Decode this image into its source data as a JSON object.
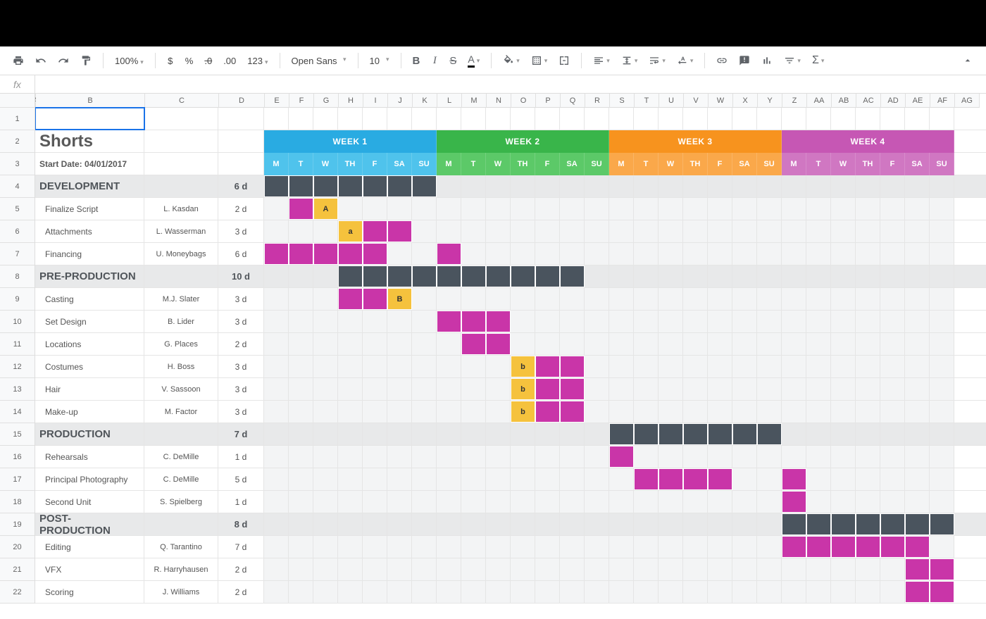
{
  "toolbar": {
    "zoom": "100%",
    "currency": "$",
    "percent": "%",
    "dec_dec": ".0",
    "dec_inc": ".00",
    "format123": "123",
    "font": "Open Sans",
    "fontsize": "10"
  },
  "columns": [
    "A",
    "B",
    "C",
    "D",
    "E",
    "F",
    "G",
    "H",
    "I",
    "J",
    "K",
    "L",
    "M",
    "N",
    "O",
    "P",
    "Q",
    "R",
    "S",
    "T",
    "U",
    "V",
    "W",
    "X",
    "Y",
    "Z",
    "AA",
    "AB",
    "AC",
    "AD",
    "AE",
    "AF",
    "AG"
  ],
  "rownums": [
    "1",
    "2",
    "3",
    "4",
    "5",
    "6",
    "7",
    "8",
    "9",
    "10",
    "11",
    "12",
    "13",
    "14",
    "15",
    "16",
    "17",
    "18",
    "19",
    "20",
    "21",
    "22"
  ],
  "title": "Shorts",
  "start_date_label": "Start Date: 04/01/2017",
  "weeks": [
    {
      "label": "WEEK 1",
      "class": "w1"
    },
    {
      "label": "WEEK 2",
      "class": "w2"
    },
    {
      "label": "WEEK 3",
      "class": "w3"
    },
    {
      "label": "WEEK 4",
      "class": "w4"
    }
  ],
  "days": [
    "M",
    "T",
    "W",
    "TH",
    "F",
    "SA",
    "SU"
  ],
  "chart_data": {
    "type": "gantt",
    "days_per_week": 7,
    "total_days": 28,
    "sections": [
      {
        "name": "DEVELOPMENT",
        "duration": "6 d",
        "bar": [
          0,
          7
        ],
        "tasks": [
          {
            "name": "Finalize Script",
            "person": "L. Kasdan",
            "duration": "2 d",
            "cells": [
              {
                "i": 1,
                "t": "pink"
              },
              {
                "i": 2,
                "t": "yellow",
                "label": "A"
              }
            ]
          },
          {
            "name": "Attachments",
            "person": "L. Wasserman",
            "duration": "3 d",
            "cells": [
              {
                "i": 3,
                "t": "yellow",
                "label": "a"
              },
              {
                "i": 4,
                "t": "pink"
              },
              {
                "i": 5,
                "t": "pink"
              }
            ]
          },
          {
            "name": "Financing",
            "person": "U. Moneybags",
            "duration": "6 d",
            "cells": [
              {
                "i": 0,
                "t": "pink"
              },
              {
                "i": 1,
                "t": "pink"
              },
              {
                "i": 2,
                "t": "pink"
              },
              {
                "i": 3,
                "t": "pink"
              },
              {
                "i": 4,
                "t": "pink"
              },
              {
                "i": 7,
                "t": "pink"
              }
            ]
          }
        ]
      },
      {
        "name": "PRE-PRODUCTION",
        "duration": "10 d",
        "bar": [
          3,
          13
        ],
        "tasks": [
          {
            "name": "Casting",
            "person": "M.J. Slater",
            "duration": "3 d",
            "cells": [
              {
                "i": 3,
                "t": "pink"
              },
              {
                "i": 4,
                "t": "pink"
              },
              {
                "i": 5,
                "t": "yellow",
                "label": "B"
              }
            ]
          },
          {
            "name": "Set Design",
            "person": "B. Lider",
            "duration": "3 d",
            "cells": [
              {
                "i": 7,
                "t": "pink"
              },
              {
                "i": 8,
                "t": "pink"
              },
              {
                "i": 9,
                "t": "pink"
              }
            ]
          },
          {
            "name": "Locations",
            "person": "G. Places",
            "duration": "2 d",
            "cells": [
              {
                "i": 8,
                "t": "pink"
              },
              {
                "i": 9,
                "t": "pink"
              }
            ]
          },
          {
            "name": "Costumes",
            "person": "H. Boss",
            "duration": "3 d",
            "cells": [
              {
                "i": 10,
                "t": "yellow",
                "label": "b"
              },
              {
                "i": 11,
                "t": "pink"
              },
              {
                "i": 12,
                "t": "pink"
              }
            ]
          },
          {
            "name": "Hair",
            "person": "V. Sassoon",
            "duration": "3 d",
            "cells": [
              {
                "i": 10,
                "t": "yellow",
                "label": "b"
              },
              {
                "i": 11,
                "t": "pink"
              },
              {
                "i": 12,
                "t": "pink"
              }
            ]
          },
          {
            "name": "Make-up",
            "person": "M. Factor",
            "duration": "3 d",
            "cells": [
              {
                "i": 10,
                "t": "yellow",
                "label": "b"
              },
              {
                "i": 11,
                "t": "pink"
              },
              {
                "i": 12,
                "t": "pink"
              }
            ]
          }
        ]
      },
      {
        "name": "PRODUCTION",
        "duration": "7 d",
        "bar": [
          14,
          21
        ],
        "tasks": [
          {
            "name": "Rehearsals",
            "person": "C. DeMille",
            "duration": "1 d",
            "cells": [
              {
                "i": 14,
                "t": "pink"
              }
            ]
          },
          {
            "name": "Principal Photography",
            "person": "C. DeMille",
            "duration": "5 d",
            "cells": [
              {
                "i": 15,
                "t": "pink"
              },
              {
                "i": 16,
                "t": "pink"
              },
              {
                "i": 17,
                "t": "pink"
              },
              {
                "i": 18,
                "t": "pink"
              },
              {
                "i": 21,
                "t": "pink"
              }
            ]
          },
          {
            "name": "Second Unit",
            "person": "S. Spielberg",
            "duration": "1 d",
            "cells": [
              {
                "i": 21,
                "t": "pink"
              }
            ]
          }
        ]
      },
      {
        "name": "POST-PRODUCTION",
        "duration": "8 d",
        "bar": [
          21,
          28
        ],
        "tasks": [
          {
            "name": "Editing",
            "person": "Q. Tarantino",
            "duration": "7 d",
            "cells": [
              {
                "i": 21,
                "t": "pink"
              },
              {
                "i": 22,
                "t": "pink"
              },
              {
                "i": 23,
                "t": "pink"
              },
              {
                "i": 24,
                "t": "pink"
              },
              {
                "i": 25,
                "t": "pink"
              },
              {
                "i": 26,
                "t": "pink"
              }
            ]
          },
          {
            "name": "VFX",
            "person": "R. Harryhausen",
            "duration": "2 d",
            "cells": [
              {
                "i": 26,
                "t": "pink"
              },
              {
                "i": 27,
                "t": "pink"
              }
            ]
          },
          {
            "name": "Scoring",
            "person": "J. Williams",
            "duration": "2 d",
            "cells": [
              {
                "i": 26,
                "t": "pink"
              },
              {
                "i": 27,
                "t": "pink"
              }
            ]
          }
        ]
      }
    ]
  }
}
